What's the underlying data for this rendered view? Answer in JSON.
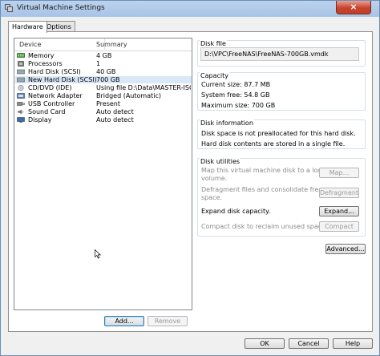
{
  "window": {
    "title": "Virtual Machine Settings",
    "close_glyph": "×"
  },
  "tabs": [
    {
      "label": "Hardware",
      "active": true
    },
    {
      "label": "Options",
      "active": false
    }
  ],
  "device_list": {
    "columns": {
      "device": "Device",
      "summary": "Summary"
    },
    "rows": [
      {
        "device": "Memory",
        "summary": "4 GB",
        "icon": "memory-icon"
      },
      {
        "device": "Processors",
        "summary": "1",
        "icon": "processor-icon"
      },
      {
        "device": "Hard Disk (SCSI)",
        "summary": "40 GB",
        "icon": "hard-disk-icon"
      },
      {
        "device": "New Hard Disk (SCSI)",
        "summary": "700 GB",
        "icon": "hard-disk-icon",
        "selected": true
      },
      {
        "device": "CD/DVD (IDE)",
        "summary": "Using file D:\\Data\\MASTER-ISO...",
        "icon": "cd-dvd-icon"
      },
      {
        "device": "Network Adapter",
        "summary": "Bridged (Automatic)",
        "icon": "network-adapter-icon"
      },
      {
        "device": "USB Controller",
        "summary": "Present",
        "icon": "usb-icon"
      },
      {
        "device": "Sound Card",
        "summary": "Auto detect",
        "icon": "sound-card-icon"
      },
      {
        "device": "Display",
        "summary": "Auto detect",
        "icon": "display-icon"
      }
    ]
  },
  "list_buttons": {
    "add": "Add...",
    "remove": "Remove"
  },
  "disk_file": {
    "title": "Disk file",
    "path": "D:\\VPC\\FreeNAS\\FreeNAS-700GB.vmdk"
  },
  "capacity": {
    "title": "Capacity",
    "current_size": "Current size: 87.7 MB",
    "system_free": "System free: 54.8 GB",
    "maximum_size": "Maximum size: 700 GB"
  },
  "disk_information": {
    "title": "Disk information",
    "line1": "Disk space is not preallocated for this hard disk.",
    "line2": "Hard disk contents are stored in a single file."
  },
  "disk_utilities": {
    "title": "Disk utilities",
    "map_desc_1": "Map this virtual machine disk to a local",
    "map_desc_2": "volume.",
    "map_button": "Map...",
    "defrag_desc_1": "Defragment files and consolidate free",
    "defrag_desc_2": "space.",
    "defrag_button": "Defragment",
    "expand_desc": "Expand disk capacity.",
    "expand_button": "Expand...",
    "compact_desc": "Compact disk to reclaim unused space.",
    "compact_button": "Compact"
  },
  "advanced_button": "Advanced...",
  "footer": {
    "ok": "OK",
    "cancel": "Cancel",
    "help": "Help"
  }
}
